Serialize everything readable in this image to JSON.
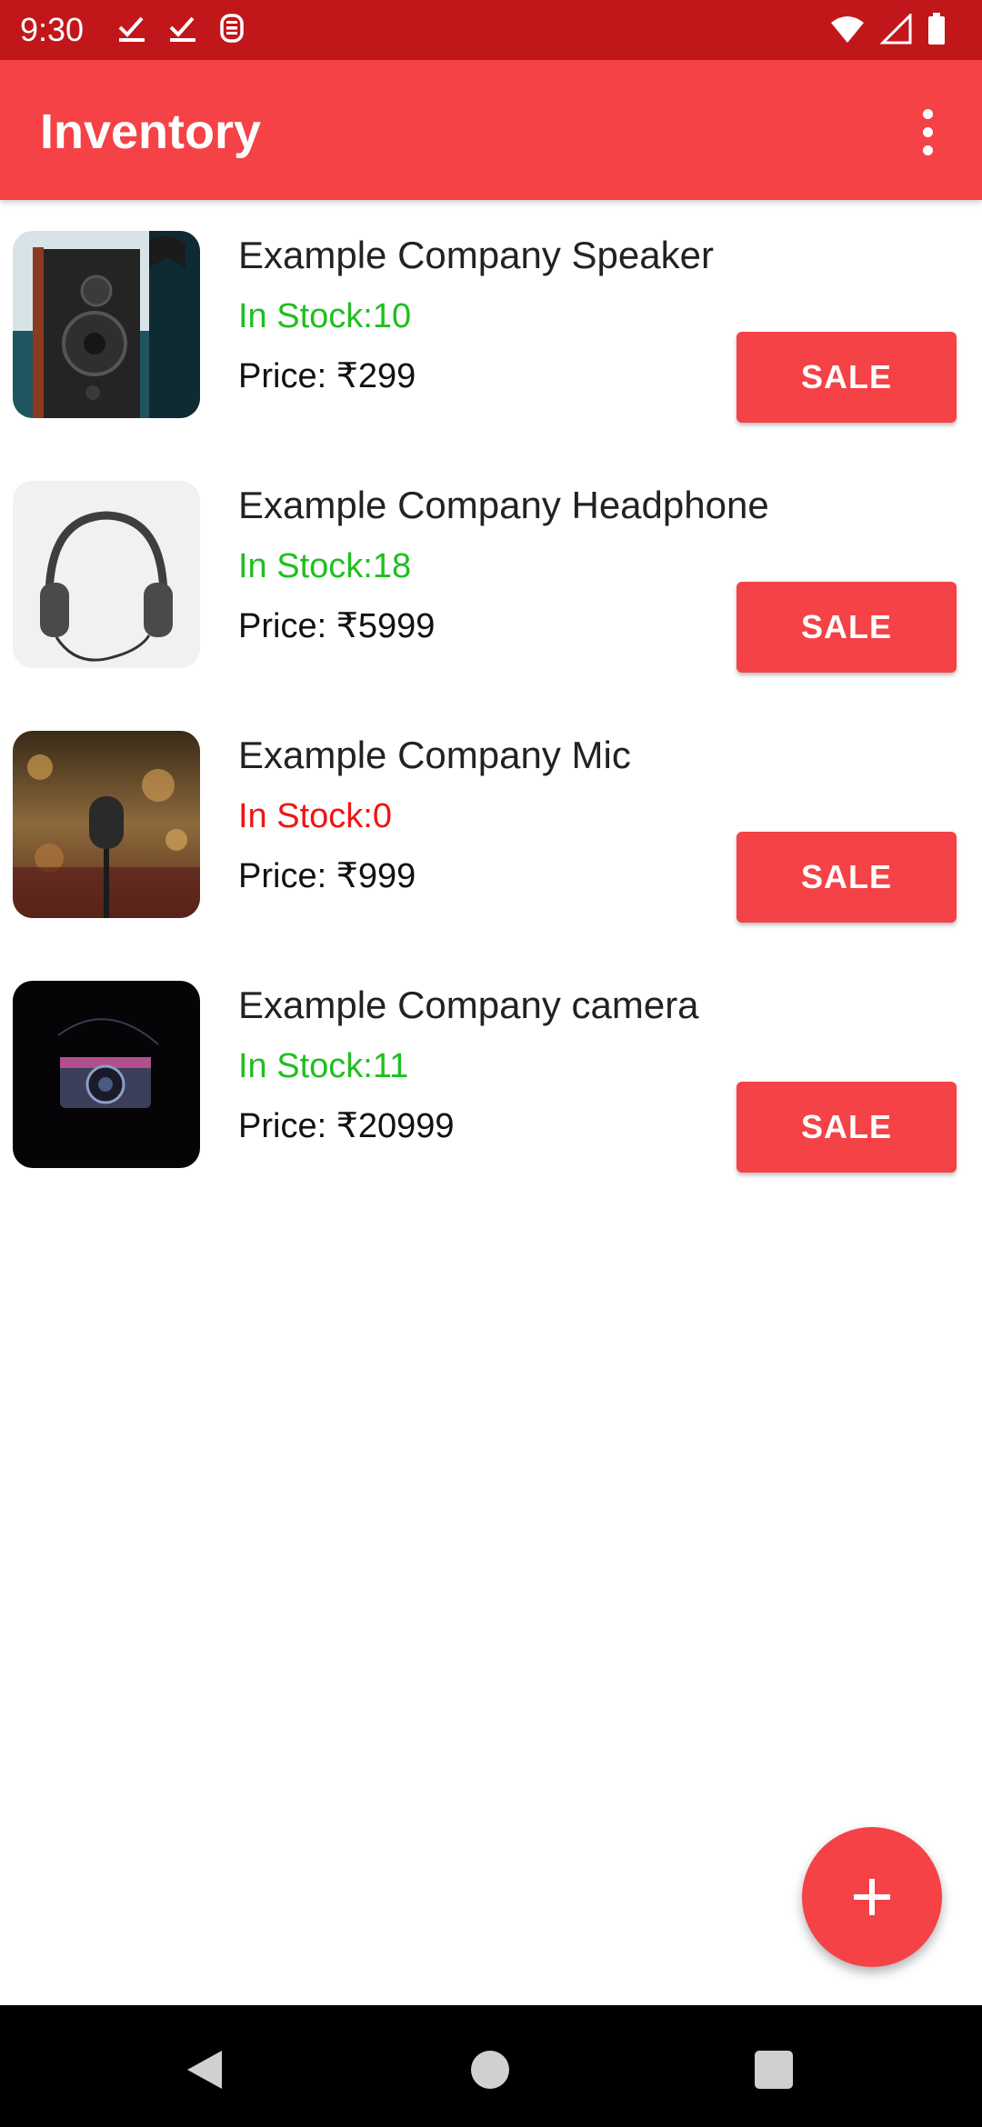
{
  "status_bar": {
    "time": "9:30",
    "left_icons": [
      "check-icon",
      "check-icon",
      "sim-icon"
    ],
    "right_icons": [
      "wifi-icon",
      "signal-icon",
      "battery-icon"
    ]
  },
  "app_bar": {
    "title": "Inventory",
    "menu_icon": "more-vert-icon",
    "color": "#f44246"
  },
  "products": [
    {
      "name": "Example Company Speaker",
      "stock": "In Stock:10",
      "in_stock": true,
      "price": "Price: ₹299",
      "sale_label": "SALE",
      "image": "speaker-image"
    },
    {
      "name": "Example Company Headphone",
      "stock": "In Stock:18",
      "in_stock": true,
      "price": "Price: ₹5999",
      "sale_label": "SALE",
      "image": "headphone-image"
    },
    {
      "name": "Example Company Mic",
      "stock": "In Stock:0",
      "in_stock": false,
      "price": "Price: ₹999",
      "sale_label": "SALE",
      "image": "mic-image"
    },
    {
      "name": "Example Company camera",
      "stock": "In Stock:11",
      "in_stock": true,
      "price": "Price: ₹20999",
      "sale_label": "SALE",
      "image": "camera-image"
    }
  ],
  "colors": {
    "in_stock": "#1fbf1f",
    "out_of_stock": "#f01414",
    "accent": "#f44246",
    "status_bar": "#c1171b"
  },
  "fab": {
    "icon": "plus-icon"
  },
  "nav_bar": {
    "icons": [
      "back-icon",
      "home-icon",
      "recents-icon"
    ]
  }
}
